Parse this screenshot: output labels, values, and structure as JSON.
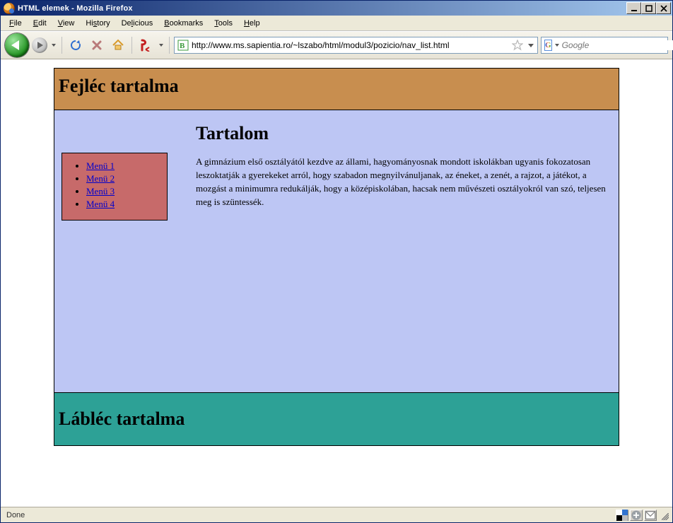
{
  "window": {
    "title": "HTML elemek - Mozilla Firefox"
  },
  "menubar": {
    "items": [
      {
        "label": "File",
        "accel": "F"
      },
      {
        "label": "Edit",
        "accel": "E"
      },
      {
        "label": "View",
        "accel": "V"
      },
      {
        "label": "History",
        "accel": "s"
      },
      {
        "label": "Delicious",
        "accel": "l"
      },
      {
        "label": "Bookmarks",
        "accel": "B"
      },
      {
        "label": "Tools",
        "accel": "T"
      },
      {
        "label": "Help",
        "accel": "H"
      }
    ]
  },
  "toolbar": {
    "url": "http://www.ms.sapientia.ro/~lszabo/html/modul3/pozicio/nav_list.html",
    "search_engine_initial": "G",
    "search_placeholder": "Google"
  },
  "page": {
    "header_title": "Fejléc tartalma",
    "content_title": "Tartalom",
    "content_body": "A gimnázium első osztályától kezdve az állami, hagyományosnak mondott iskolákban ugyanis fokozatosan leszoktatják a gyerekeket arról, hogy szabadon megnyilvánuljanak, az éneket, a zenét, a rajzot, a játékot, a mozgást a minimumra redukálják, hogy a középiskolában, hacsak nem művészeti osztályokról van szó, teljesen meg is szüntessék.",
    "nav_items": [
      "Menü 1",
      "Menü 2",
      "Menü 3",
      "Menü 4"
    ],
    "footer_title": "Lábléc tartalma"
  },
  "statusbar": {
    "text": "Done"
  }
}
